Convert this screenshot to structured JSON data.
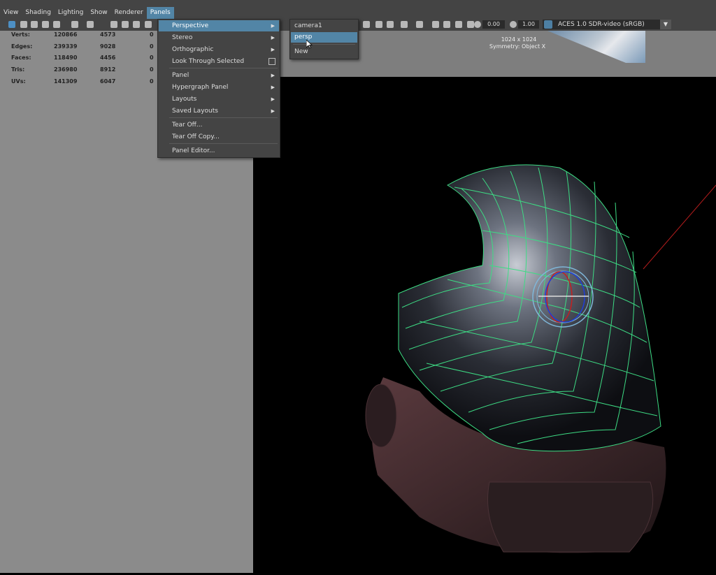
{
  "menubar": {
    "items": [
      "View",
      "Shading",
      "Lighting",
      "Show",
      "Renderer",
      "Panels"
    ],
    "active": "Panels"
  },
  "toolbar": {
    "field1": "0.00",
    "field2": "1.00",
    "color_space": "ACES 1.0 SDR-video (sRGB)"
  },
  "hud": {
    "rows": [
      {
        "label": "Verts:",
        "v1": "120866",
        "v2": "4573",
        "v3": "0"
      },
      {
        "label": "Edges:",
        "v1": "239339",
        "v2": "9028",
        "v3": "0"
      },
      {
        "label": "Faces:",
        "v1": "118490",
        "v2": "4456",
        "v3": "0"
      },
      {
        "label": "Tris:",
        "v1": "236980",
        "v2": "8912",
        "v3": "0"
      },
      {
        "label": "UVs:",
        "v1": "141309",
        "v2": "6047",
        "v3": "0"
      }
    ]
  },
  "viewport": {
    "resolution": "1024 x 1024",
    "symmetry": "Symmetry: Object X"
  },
  "panels_menu": {
    "items": [
      "Perspective",
      "Stereo",
      "Orthographic",
      "Look Through Selected",
      "Panel",
      "Hypergraph Panel",
      "Layouts",
      "Saved Layouts",
      "Tear Off...",
      "Tear Off Copy...",
      "Panel Editor..."
    ]
  },
  "perspective_submenu": {
    "items": [
      "camera1",
      "persp",
      "New"
    ]
  },
  "colors": {
    "accent": "#5285a6",
    "wire": "#3ddc84",
    "ui_bg": "#444444"
  }
}
